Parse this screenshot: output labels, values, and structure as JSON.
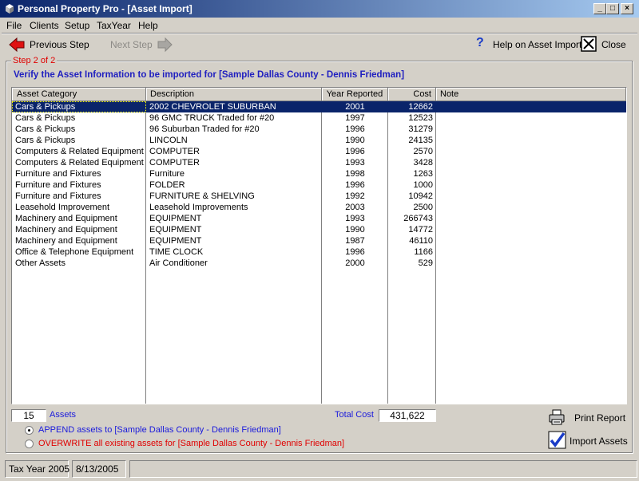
{
  "window": {
    "title": "Personal Property Pro - [Asset Import]"
  },
  "menu": [
    {
      "label": "File",
      "underline": "F"
    },
    {
      "label": "Clients",
      "underline": "C"
    },
    {
      "label": "Setup",
      "underline": "S"
    },
    {
      "label": "TaxYear",
      "underline": "Y"
    },
    {
      "label": "Help",
      "underline": "H"
    }
  ],
  "toolbar": {
    "previous_step": "Previous Step",
    "next_step": "Next Step",
    "help": "Help on Asset Import",
    "close": "Close"
  },
  "step_label": "Step 2 of 2",
  "heading": "Verify the Asset Information to be imported for [Sample Dallas County - Dennis Friedman]",
  "grid": {
    "columns": [
      "Asset Category",
      "Description",
      "Year Reported",
      "Cost",
      "Note"
    ],
    "rows": [
      [
        "Cars & Pickups",
        "2002 CHEVROLET SUBURBAN",
        "2001",
        "12662",
        ""
      ],
      [
        "Cars & Pickups",
        "96 GMC TRUCK Traded for #20",
        "1997",
        "12523",
        ""
      ],
      [
        "Cars & Pickups",
        "96 Suburban Traded for #20",
        "1996",
        "31279",
        ""
      ],
      [
        "Cars & Pickups",
        "LINCOLN",
        "1990",
        "24135",
        ""
      ],
      [
        "Computers & Related Equipment",
        "COMPUTER",
        "1996",
        "2570",
        ""
      ],
      [
        "Computers & Related Equipment",
        "COMPUTER",
        "1993",
        "3428",
        ""
      ],
      [
        "Furniture and Fixtures",
        "Furniture",
        "1998",
        "1263",
        ""
      ],
      [
        "Furniture and Fixtures",
        "FOLDER",
        "1996",
        "1000",
        ""
      ],
      [
        "Furniture and Fixtures",
        "FURNITURE & SHELVING",
        "1992",
        "10942",
        ""
      ],
      [
        "Leasehold Improvement",
        "Leasehold Improvements",
        "2003",
        "2500",
        ""
      ],
      [
        "Machinery and Equipment",
        "EQUIPMENT",
        "1993",
        "266743",
        ""
      ],
      [
        "Machinery and Equipment",
        "EQUIPMENT",
        "1990",
        "14772",
        ""
      ],
      [
        "Machinery and Equipment",
        "EQUIPMENT",
        "1987",
        "46110",
        ""
      ],
      [
        "Office & Telephone Equipment",
        "TIME CLOCK",
        "1996",
        "1166",
        ""
      ],
      [
        "Other Assets",
        "Air Conditioner",
        "2000",
        "529",
        ""
      ]
    ],
    "selected_row": 0
  },
  "summary": {
    "asset_count": "15",
    "assets_label": "Assets",
    "total_cost_label": "Total Cost",
    "total_cost": "431,622"
  },
  "options": {
    "append_label": "APPEND assets to [Sample Dallas County - Dennis Friedman]",
    "overwrite_label": "OVERWRITE all existing assets for [Sample Dallas County - Dennis Friedman]",
    "selected": "append"
  },
  "actions": {
    "print_report": "Print Report",
    "import_assets": "Import Assets"
  },
  "status": {
    "tax_year": "Tax Year 2005",
    "date": "8/13/2005"
  },
  "colors": {
    "title_bar": "#0a246a",
    "heading": "#2020c0",
    "step_label": "#e00000",
    "selection": "#0a246a"
  },
  "icons": [
    "app-icon",
    "previous-arrow-icon",
    "next-arrow-icon",
    "help-question-icon",
    "close-x-icon",
    "printer-icon",
    "checkmark-icon"
  ]
}
